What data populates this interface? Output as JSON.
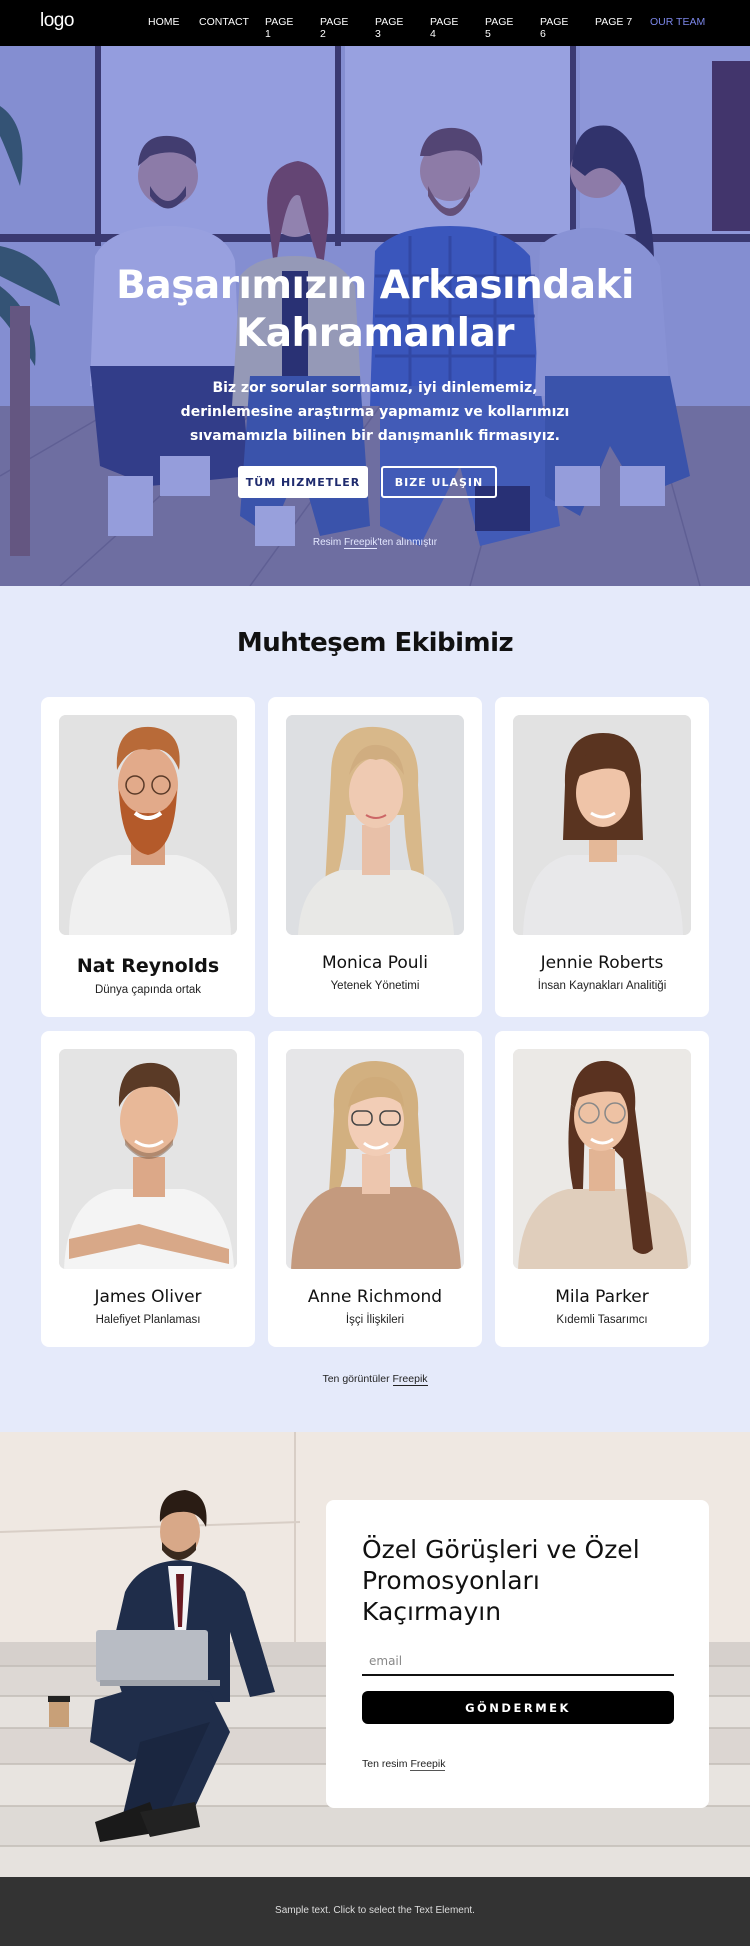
{
  "nav": {
    "logo": "logo",
    "items": [
      {
        "label": "HOME",
        "active": false
      },
      {
        "label": "CONTACT",
        "active": false
      },
      {
        "label": "PAGE 1",
        "active": false
      },
      {
        "label": "PAGE 2",
        "active": false
      },
      {
        "label": "PAGE 3",
        "active": false
      },
      {
        "label": "PAGE 4",
        "active": false
      },
      {
        "label": "PAGE 5",
        "active": false
      },
      {
        "label": "PAGE 6",
        "active": false
      },
      {
        "label": "PAGE 7",
        "active": false
      },
      {
        "label": "OUR TEAM",
        "active": true
      }
    ],
    "active_color": "#7b86e8"
  },
  "hero": {
    "title_line1": "Başarımızın Arkasındaki",
    "title_line2": "Kahramanlar",
    "text": "Biz zor sorular sormamız, iyi dinlememiz, derinlemesine araştırma yapmamız ve kollarımızı sıvamamızla bilinen bir danışmanlık firmasıyız.",
    "primary_button": "TÜM HIZMETLER",
    "secondary_button": "BIZE ULAŞIN",
    "credit_prefix": "Resim ",
    "credit_link": "Freepik",
    "credit_suffix": "'ten alınmıştır",
    "overlay_color": "#3a4cc8"
  },
  "team": {
    "title": "Muhteşem Ekibimiz",
    "members": [
      {
        "name": "Nat Reynolds",
        "role": "Dünya çapında ortak",
        "photo": "man-red-beard-glasses"
      },
      {
        "name": "Monica Pouli",
        "role": "Yetenek Yönetimi",
        "photo": "woman-blonde-long-hair"
      },
      {
        "name": "Jennie Roberts",
        "role": "İnsan Kaynakları Analitiği",
        "photo": "woman-brown-bob"
      },
      {
        "name": "James Oliver",
        "role": "Halefiyet Planlaması",
        "photo": "man-brown-hair-smiling"
      },
      {
        "name": "Anne Richmond",
        "role": "İşçi İlişkileri",
        "photo": "woman-blonde-glasses"
      },
      {
        "name": "Mila Parker",
        "role": "Kıdemli Tasarımcı",
        "photo": "woman-brunette-glasses"
      }
    ],
    "credit_prefix": "Ten görüntüler ",
    "credit_link": "Freepik",
    "background": "#e5eafa"
  },
  "subscribe": {
    "title": "Özel Görüşleri ve Özel Promosyonları Kaçırmayın",
    "email_placeholder": "email",
    "email_value": "",
    "button": "GÖNDERMEK",
    "credit_prefix": "Ten resim ",
    "credit_link": "Freepik"
  },
  "footer": {
    "text": "Sample text. Click to select the Text Element."
  }
}
